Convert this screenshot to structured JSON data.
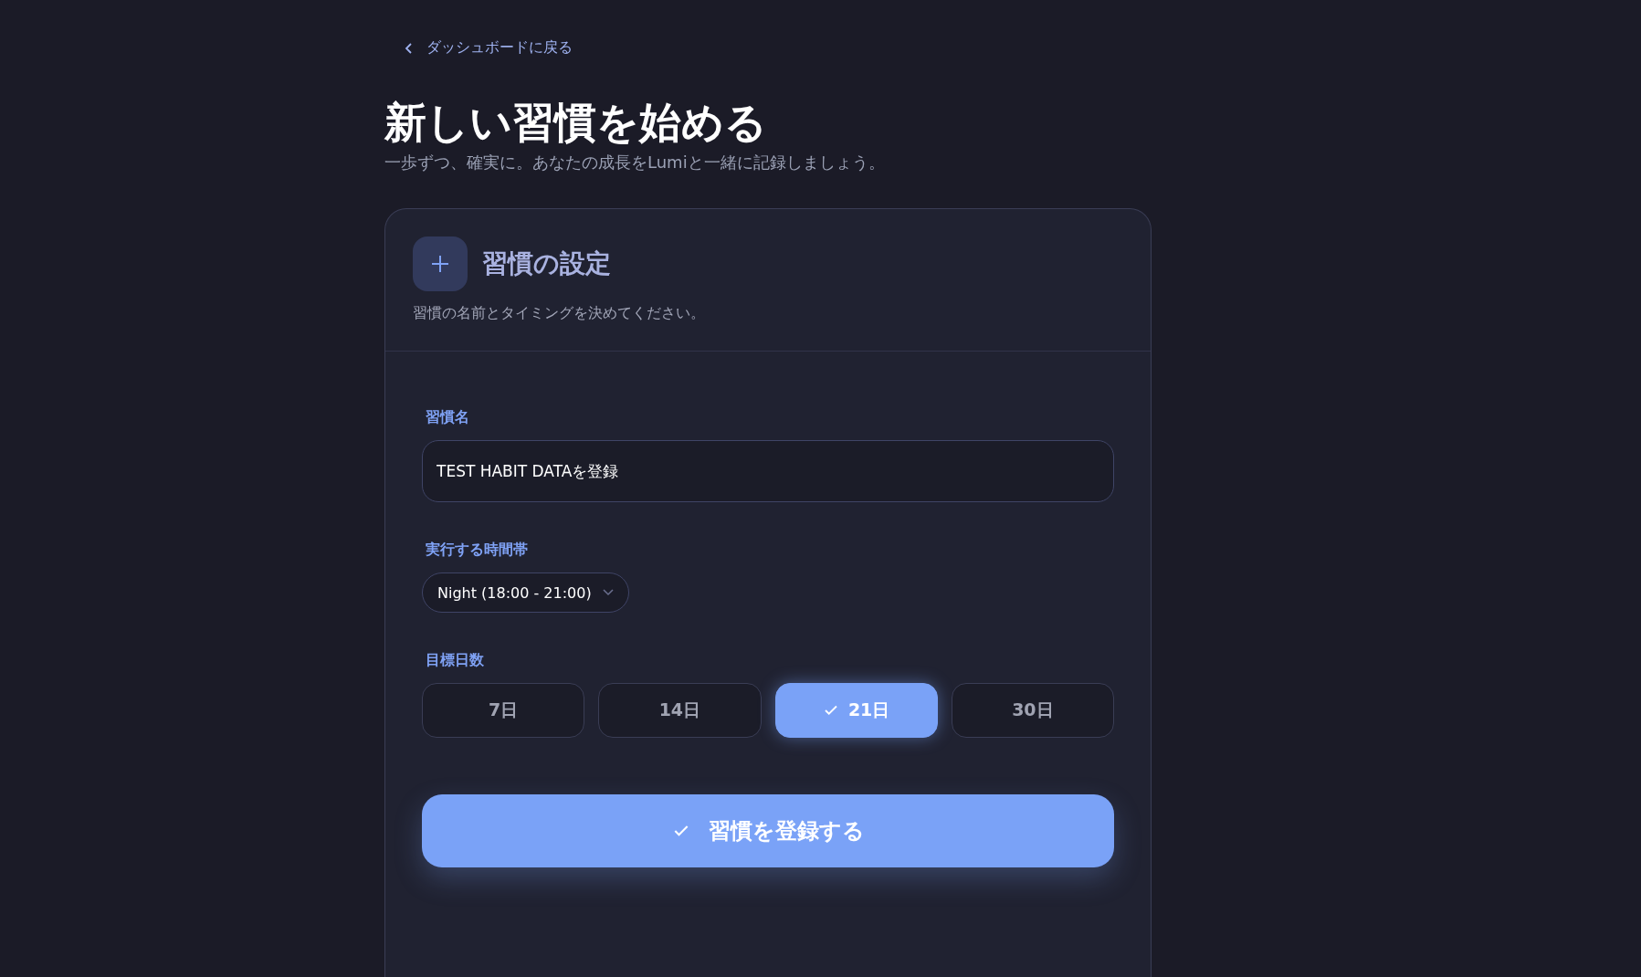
{
  "back_link": {
    "label": "ダッシュボードに戻る"
  },
  "page_title": "新しい習慣を始める",
  "page_subtitle": "一歩ずつ、確実に。あなたの成長をLumiと一緒に記録しましょう。",
  "card": {
    "title": "習慣の設定",
    "description": "習慣の名前とタイミングを決めてください。"
  },
  "habit_name": {
    "label": "習慣名",
    "value": "TEST HABIT DATAを登録"
  },
  "time_slot": {
    "label": "実行する時間帯",
    "value": "Night (18:00 - 21:00)"
  },
  "target_days": {
    "label": "目標日数",
    "options": [
      {
        "label": "7日",
        "selected": false
      },
      {
        "label": "14日",
        "selected": false
      },
      {
        "label": "21日",
        "selected": true
      },
      {
        "label": "30日",
        "selected": false
      }
    ]
  },
  "submit_button": {
    "label": "習慣を登録する"
  }
}
